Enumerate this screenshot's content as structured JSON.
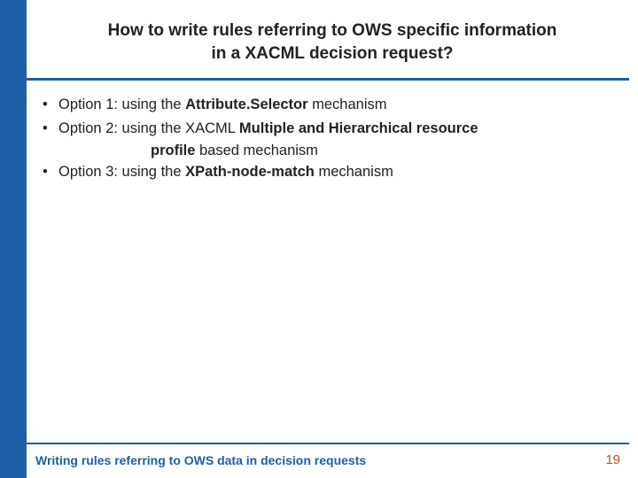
{
  "title_line1": "How to write rules referring to OWS specific information",
  "title_line2": "in a XACML decision request?",
  "bullets": {
    "b1_pre": "Option 1: using the ",
    "b1_bold": "Attribute.Selector",
    "b1_post": " mechanism",
    "b2_pre": "Option 2: using the XACML ",
    "b2_bold": "Multiple and Hierarchical resource",
    "b2_cont_bold": "profile",
    "b2_cont_post": " based mechanism",
    "b3_pre": "Option 3: using the ",
    "b3_bold": "XPath-node-match",
    "b3_post": " mechanism"
  },
  "footer_text": "Writing rules referring to OWS data in decision requests",
  "page_number": "19"
}
